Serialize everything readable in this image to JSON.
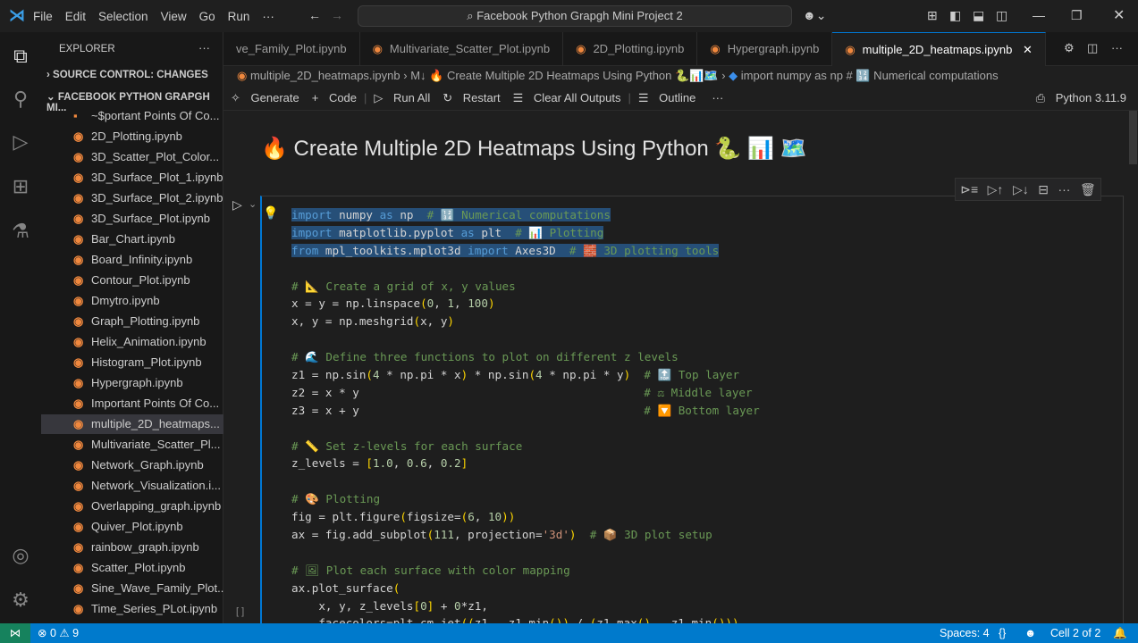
{
  "titlebar": {
    "menu": [
      "File",
      "Edit",
      "Selection",
      "View",
      "Go",
      "Run",
      "···"
    ],
    "search": "Facebook Python Grapgh Mini Project 2"
  },
  "sidebar": {
    "explorer": "EXPLORER",
    "source_control": "SOURCE CONTROL: CHANGES",
    "folder": "FACEBOOK PYTHON GRAPGH MI...",
    "files": [
      "~$portant Points Of Co...",
      "2D_Plotting.ipynb",
      "3D_Scatter_Plot_Color...",
      "3D_Surface_Plot_1.ipynb",
      "3D_Surface_Plot_2.ipynb",
      "3D_Surface_Plot.ipynb",
      "Bar_Chart.ipynb",
      "Board_Infinity.ipynb",
      "Contour_Plot.ipynb",
      "Dmytro.ipynb",
      "Graph_Plotting.ipynb",
      "Helix_Animation.ipynb",
      "Histogram_Plot.ipynb",
      "Hypergraph.ipynb",
      "Important Points Of Co...",
      "multiple_2D_heatmaps...",
      "Multivariate_Scatter_Pl...",
      "Network_Graph.ipynb",
      "Network_Visualization.i...",
      "Overlapping_graph.ipynb",
      "Quiver_Plot.ipynb",
      "rainbow_graph.ipynb",
      "Scatter_Plot.ipynb",
      "Sine_Wave_Family_Plot....",
      "Time_Series_PLot.ipynb"
    ]
  },
  "tabs": [
    "ve_Family_Plot.ipynb",
    "Multivariate_Scatter_Plot.ipynb",
    "2D_Plotting.ipynb",
    "Hypergraph.ipynb",
    "multiple_2D_heatmaps.ipynb"
  ],
  "breadcrumb": [
    "multiple_2D_heatmaps.ipynb",
    "M↓ 🔥 Create Multiple 2D Heatmaps Using Python 🐍📊🗺️",
    "import numpy as np  # 🔢 Numerical computations"
  ],
  "toolbar": {
    "generate": "Generate",
    "code": "Code",
    "run_all": "Run All",
    "restart": "Restart",
    "clear": "Clear All Outputs",
    "outline": "Outline",
    "kernel": "Python 3.11.9"
  },
  "markdown_title": "🔥 Create Multiple 2D Heatmaps Using Python 🐍 📊 🗺️",
  "cell": {
    "exec_count": "[ ]",
    "code": [
      "import numpy as np  # 🔢 Numerical computations",
      "import matplotlib.pyplot as plt  # 📊 Plotting",
      "from mpl_toolkits.mplot3d import Axes3D  # 🧱 3D plotting tools",
      "",
      "# 📐 Create a grid of x, y values",
      "x = y = np.linspace(0, 1, 100)",
      "x, y = np.meshgrid(x, y)",
      "",
      "# 🌊 Define three functions to plot on different z levels",
      "z1 = np.sin(4 * np.pi * x) * np.sin(4 * np.pi * y)  # 🔝 Top layer",
      "z2 = x * y                                          # ⚖ Middle layer",
      "z3 = x + y                                          # 🔽 Bottom layer",
      "",
      "# 📏 Set z-levels for each surface",
      "z_levels = [1.0, 0.6, 0.2]",
      "",
      "# 🎨 Plotting",
      "fig = plt.figure(figsize=(6, 10))",
      "ax = fig.add_subplot(111, projection='3d')  # 📦 3D plot setup",
      "",
      "# 🖼 Plot each surface with color mapping",
      "ax.plot_surface(",
      "    x, y, z_levels[0] + 0*z1,",
      "    facecolors=plt.cm.jet((z1 - z1.min()) / (z1.max() - z1.min())),"
    ],
    "selected_lines": 3
  },
  "status": {
    "errors": "0",
    "warnings": "9",
    "spaces": "Spaces: 4",
    "braces": "{}",
    "cell": "Cell 2 of 2"
  }
}
